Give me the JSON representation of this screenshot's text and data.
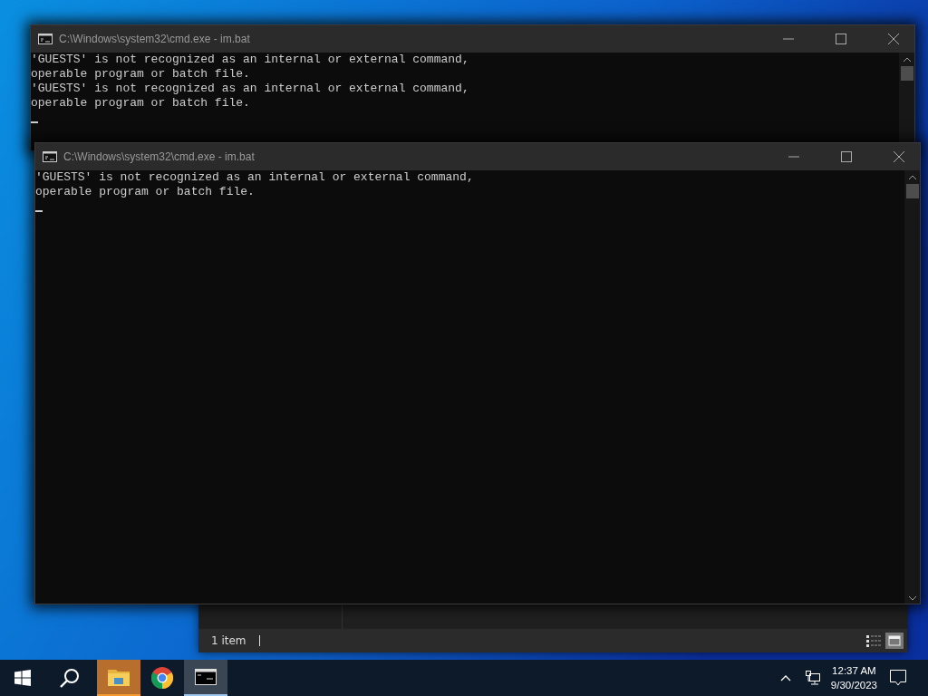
{
  "windows": [
    {
      "title": "C:\\Windows\\system32\\cmd.exe - im.bat",
      "lines": [
        "'GUESTS' is not recognized as an internal or external command,",
        "operable program or batch file.",
        "'GUESTS' is not recognized as an internal or external command,",
        "operable program or batch file."
      ]
    },
    {
      "title": "C:\\Windows\\system32\\cmd.exe - im.bat",
      "lines": [
        "'GUESTS' is not recognized as an internal or external command,",
        "operable program or batch file."
      ]
    }
  ],
  "explorer": {
    "status": "1 item"
  },
  "taskbar": {
    "apps": [
      {
        "kind": "explorer",
        "selected": false,
        "flashing": true
      },
      {
        "kind": "chrome",
        "selected": false,
        "flashing": false
      },
      {
        "kind": "cmd",
        "selected": true,
        "flashing": false
      }
    ],
    "time": "12:37 AM",
    "date": "9/30/2023"
  }
}
